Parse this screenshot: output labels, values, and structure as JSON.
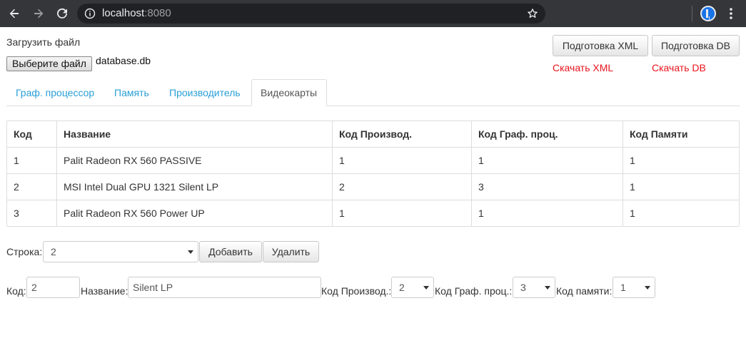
{
  "browser": {
    "url_host": "localhost",
    "url_port": ":8080"
  },
  "upload": {
    "label": "Загрузить файл",
    "choose_button": "Выберите файл",
    "file_name": "database.db"
  },
  "actions": {
    "prepare_xml": "Подготовка XML",
    "prepare_db": "Подготовка DB",
    "download_xml": "Скачать XML",
    "download_db": "Скачать DB",
    "link_color": "#e8141c"
  },
  "tabs": [
    {
      "label": "Граф. процессор"
    },
    {
      "label": "Память"
    },
    {
      "label": "Производитель"
    },
    {
      "label": "Видеокарты"
    }
  ],
  "active_tab": "Видеокарты",
  "table": {
    "headers": [
      "Код",
      "Название",
      "Код Производ.",
      "Код Граф. проц.",
      "Код Памяти"
    ],
    "rows": [
      [
        "1",
        "Palit Radeon RX 560 PASSIVE",
        "1",
        "1",
        "1"
      ],
      [
        "2",
        "MSI Intel Dual GPU 1321 Silent LP",
        "2",
        "3",
        "1"
      ],
      [
        "3",
        "Palit Radeon RX 560 Power UP",
        "1",
        "1",
        "1"
      ]
    ]
  },
  "row_controls": {
    "label": "Строка:",
    "selected_row": "2",
    "add_button": "Добавить",
    "delete_button": "Удалить"
  },
  "form": {
    "code_label": "Код:",
    "code_value": "2",
    "name_label": "Название:",
    "name_value": "Silent LP",
    "maker_label": "Код Производ.:",
    "maker_value": "2",
    "gpu_label": "Код Граф. проц.:",
    "gpu_value": "3",
    "memory_label": "Код памяти:",
    "memory_value": "1"
  },
  "colors": {
    "chrome_bg": "#35363a",
    "omnibox_bg": "#202124",
    "tab_link": "#2a9fd6"
  }
}
